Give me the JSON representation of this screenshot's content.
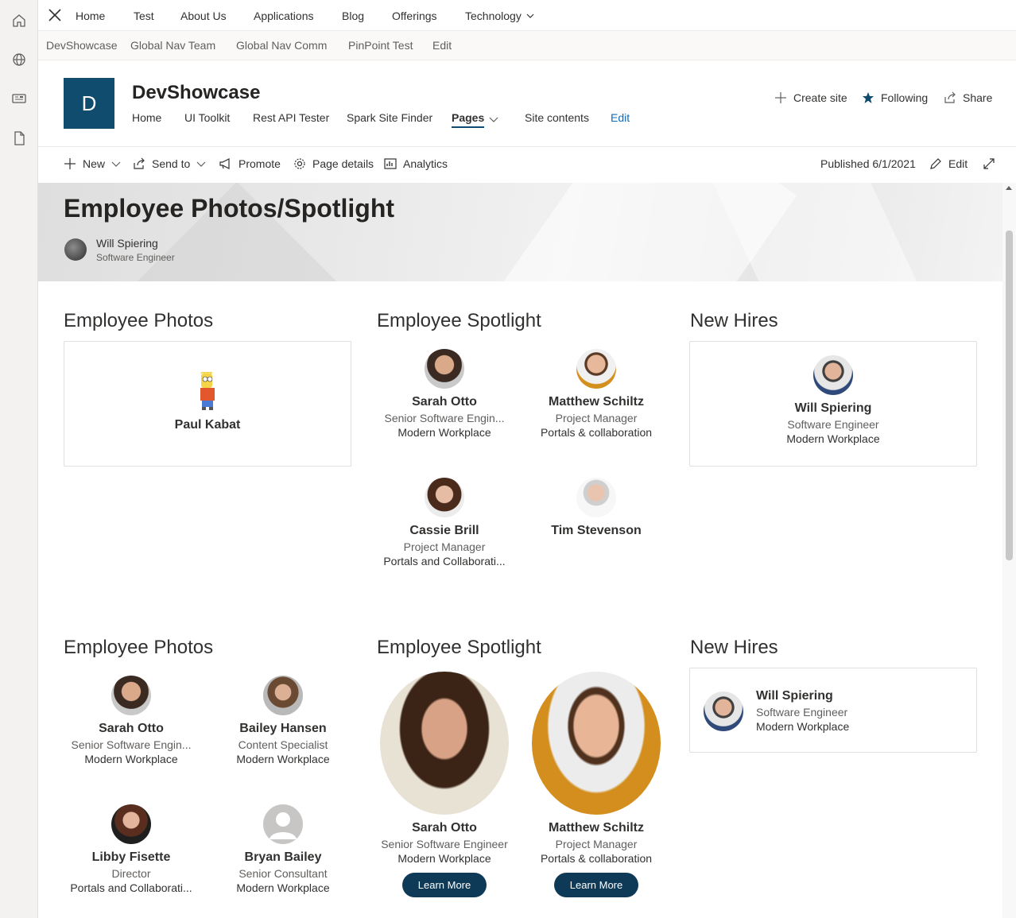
{
  "global_nav": {
    "items": [
      "Home",
      "Test",
      "About Us",
      "Applications",
      "Blog",
      "Offerings",
      "Technology"
    ]
  },
  "sub_nav": {
    "items": [
      "DevShowcase",
      "Global Nav Team",
      "Global Nav Comm",
      "PinPoint Test",
      "Edit"
    ]
  },
  "site": {
    "logo_letter": "D",
    "title": "DevShowcase",
    "links": [
      "Home",
      "UI Toolkit",
      "Rest API Tester",
      "Spark Site Finder",
      "Pages",
      "Site contents",
      "Edit"
    ],
    "actions": {
      "create_site": "Create site",
      "following": "Following",
      "share": "Share"
    }
  },
  "command_bar": {
    "new": "New",
    "send_to": "Send to",
    "promote": "Promote",
    "page_details": "Page details",
    "analytics": "Analytics",
    "published": "Published 6/1/2021",
    "edit": "Edit"
  },
  "page": {
    "title": "Employee Photos/Spotlight",
    "author_name": "Will Spiering",
    "author_role": "Software Engineer"
  },
  "row1": {
    "photos_title": "Employee Photos",
    "photos_person": {
      "name": "Paul Kabat"
    },
    "spotlight_title": "Employee Spotlight",
    "spotlight": [
      {
        "name": "Sarah Otto",
        "role": "Senior Software Engin...",
        "dept": "Modern Workplace"
      },
      {
        "name": "Matthew Schiltz",
        "role": "Project Manager",
        "dept": "Portals & collaboration"
      },
      {
        "name": "Cassie Brill",
        "role": "Project Manager",
        "dept": "Portals and Collaborati..."
      },
      {
        "name": "Tim Stevenson"
      }
    ],
    "newhires_title": "New Hires",
    "newhire": {
      "name": "Will Spiering",
      "role": "Software Engineer",
      "dept": "Modern Workplace"
    }
  },
  "row2": {
    "photos_title": "Employee Photos",
    "photos": [
      {
        "name": "Sarah Otto",
        "role": "Senior Software Engin...",
        "dept": "Modern Workplace"
      },
      {
        "name": "Bailey Hansen",
        "role": "Content Specialist",
        "dept": "Modern Workplace"
      },
      {
        "name": "Libby Fisette",
        "role": "Director",
        "dept": "Portals and Collaborati..."
      },
      {
        "name": "Bryan Bailey",
        "role": "Senior Consultant",
        "dept": "Modern Workplace"
      }
    ],
    "spotlight_title": "Employee Spotlight",
    "spotlight": [
      {
        "name": "Sarah Otto",
        "role": "Senior Software Engineer",
        "dept": "Modern Workplace",
        "button": "Learn More"
      },
      {
        "name": "Matthew Schiltz",
        "role": "Project Manager",
        "dept": "Portals & collaboration",
        "button": "Learn More"
      }
    ],
    "newhires_title": "New Hires",
    "newhire": {
      "name": "Will Spiering",
      "role": "Software Engineer",
      "dept": "Modern Workplace"
    }
  },
  "colors": {
    "accent": "#0f4c6e",
    "button": "#0f3a57",
    "link": "#0f6cbd"
  }
}
